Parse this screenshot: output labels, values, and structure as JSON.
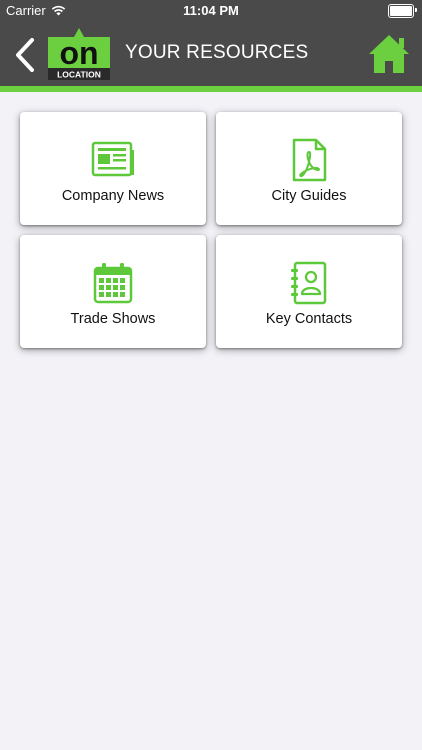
{
  "status_bar": {
    "carrier": "Carrier",
    "time": "11:04 PM"
  },
  "navbar": {
    "logo_text_main": "on",
    "logo_text_sub": "LOCATION",
    "title": "YOUR RESOURCES"
  },
  "tiles": [
    {
      "label": "Company News",
      "icon": "newspaper-icon"
    },
    {
      "label": "City Guides",
      "icon": "pdf-document-icon"
    },
    {
      "label": "Trade Shows",
      "icon": "calendar-icon"
    },
    {
      "label": "Key Contacts",
      "icon": "contact-book-icon"
    }
  ],
  "colors": {
    "accent": "#6ccf3f",
    "header": "#4a4a4a",
    "icon": "#5cc83a"
  }
}
